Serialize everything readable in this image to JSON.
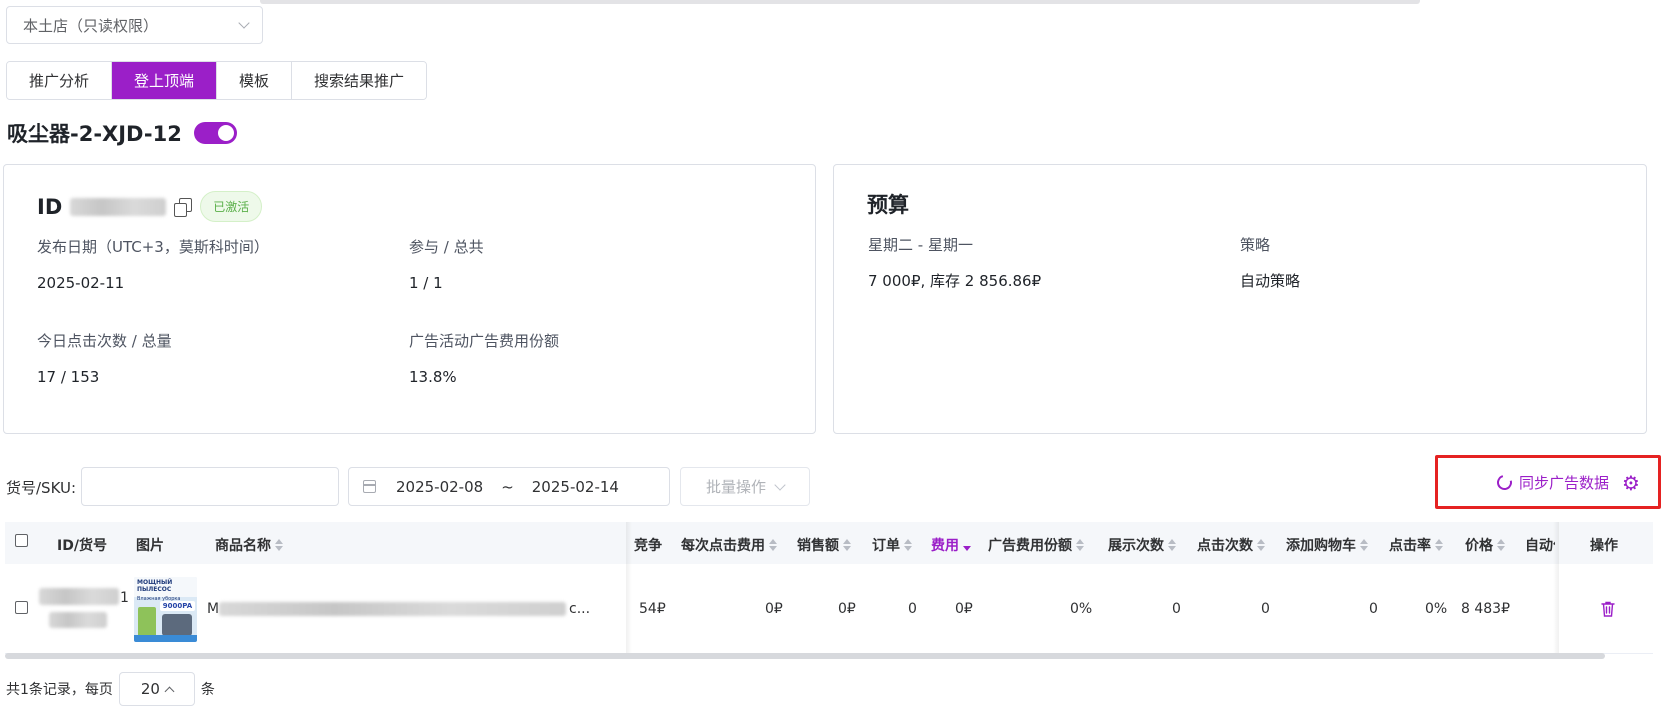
{
  "store": {
    "selected": "本土店（只读权限）"
  },
  "tabs": [
    {
      "label": "推广分析",
      "active": false
    },
    {
      "label": "登上顶端",
      "active": true
    },
    {
      "label": "模板",
      "active": false
    },
    {
      "label": "搜索结果推广",
      "active": false
    }
  ],
  "campaign": {
    "name": "吸尘器-2-XJD-12",
    "enabled": true
  },
  "info_card": {
    "id_label": "ID",
    "status_badge": "已激活",
    "publish_date_label": "发布日期（UTC+3，莫斯科时间）",
    "publish_date_value": "2025-02-11",
    "participation_label": "参与 / 总共",
    "participation_value": "1 / 1",
    "clicks_label": "今日点击次数 / 总量",
    "clicks_value": "17 / 153",
    "share_label": "广告活动广告费用份额",
    "share_value": "13.8%"
  },
  "budget_card": {
    "title": "预算",
    "period_label": "星期二 - 星期一",
    "period_value": "7 000₽, 库存 2 856.86₽",
    "strategy_label": "策略",
    "strategy_value": "自动策略"
  },
  "filters": {
    "sku_label": "货号/SKU:",
    "sku_value": "",
    "date_from": "2025-02-08",
    "date_sep": "~",
    "date_to": "2025-02-14",
    "batch_label": "批量操作",
    "sync_label": "同步广告数据"
  },
  "table": {
    "headers": {
      "id": "ID/货号",
      "image": "图片",
      "name": "商品名称",
      "competition": "竞争",
      "cpc": "每次点击费用",
      "sales": "销售额",
      "orders": "订单",
      "cost": "费用",
      "cost_share": "广告费用份额",
      "impressions": "展示次数",
      "clicks": "点击次数",
      "add_to_cart": "添加购物车",
      "ctr": "点击率",
      "price": "价格",
      "auto": "自动化",
      "actions": "操作"
    },
    "rows": [
      {
        "id_suffix": "1",
        "name_prefix": "M",
        "name_suffix": "c...",
        "image_text_top": "МОЩНЫЙ ПЫЛЕСОС",
        "image_text_sub": "Влажная уборка",
        "image_text_badge": "9000PA",
        "competition": "54₽",
        "cpc": "0₽",
        "sales": "0₽",
        "orders": "0",
        "cost": "0₽",
        "cost_share": "0%",
        "impressions": "0",
        "clicks": "0",
        "add_to_cart": "0",
        "ctr": "0%",
        "price": "8 483₽"
      }
    ]
  },
  "pagination": {
    "total_text": "共1条记录，每页",
    "page_size": "20",
    "unit": "条"
  },
  "colors": {
    "accent": "#9b1fc8",
    "highlight_border": "#e52222",
    "badge_green": "#5bb04a"
  }
}
